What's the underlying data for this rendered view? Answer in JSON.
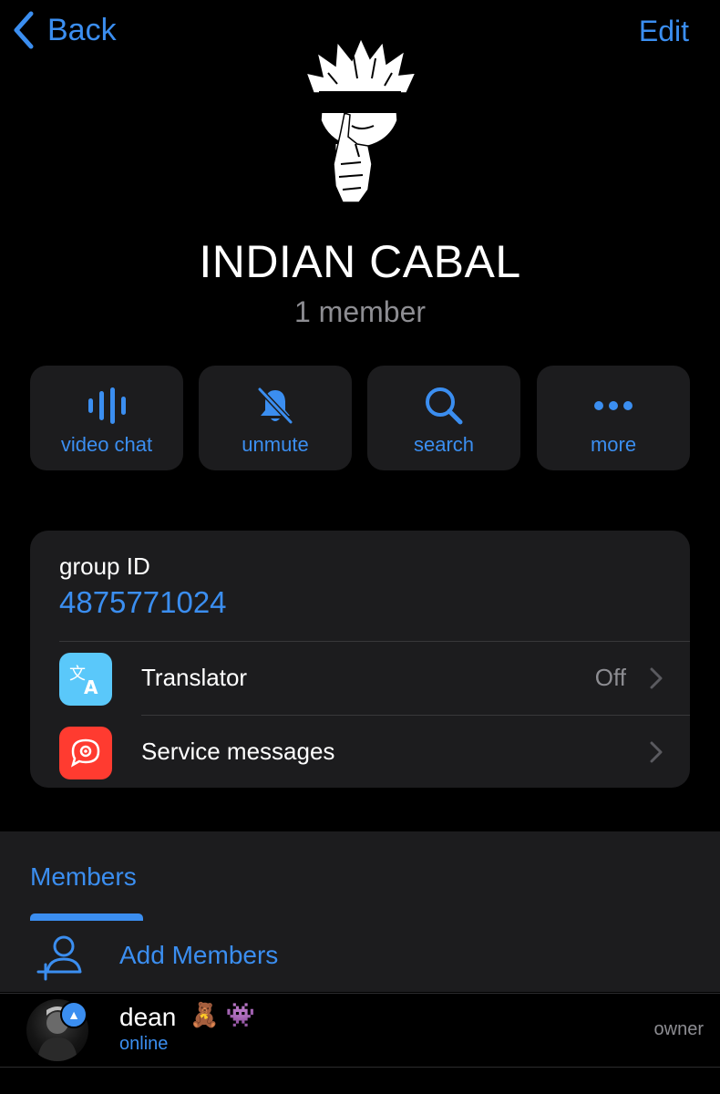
{
  "nav": {
    "back_label": "Back",
    "edit_label": "Edit"
  },
  "group": {
    "name": "INDIAN CABAL",
    "members_count": "1 member"
  },
  "actions": [
    {
      "label": "video chat",
      "icon": "waveform-icon"
    },
    {
      "label": "unmute",
      "icon": "bell-slash-icon"
    },
    {
      "label": "search",
      "icon": "magnifier-icon"
    },
    {
      "label": "more",
      "icon": "ellipsis-icon"
    }
  ],
  "info": {
    "group_id_label": "group ID",
    "group_id_value": "4875771024",
    "translator": {
      "label": "Translator",
      "value": "Off",
      "icon": "translate-icon"
    },
    "service_messages": {
      "label": "Service messages",
      "icon": "chat-gear-icon"
    }
  },
  "members_section": {
    "tab_label": "Members",
    "add_label": "Add Members",
    "list": [
      {
        "name": "dean",
        "emoji": "🧸 👾",
        "status": "online",
        "role": "owner"
      }
    ]
  },
  "colors": {
    "accent": "#3b8ef0",
    "card": "#1c1c1e",
    "translator_icon_bg": "#5ac8fa",
    "service_icon_bg": "#ff3b30"
  }
}
